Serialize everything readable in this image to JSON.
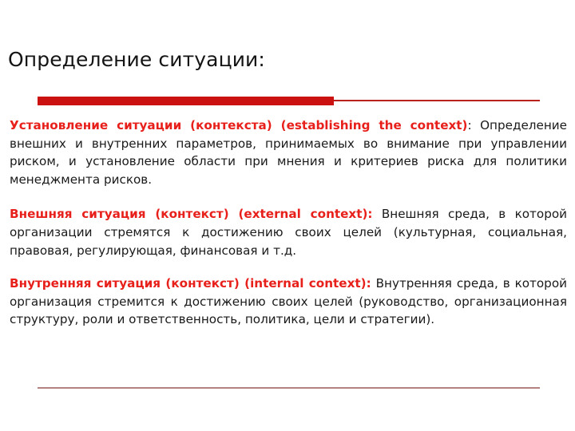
{
  "slide": {
    "title": "Определение ситуации:",
    "accent_color": "#cc1111",
    "term_color": "#e8201b",
    "bottom_rule_color": "#b58080",
    "body_text_color": "#1a1a1a"
  },
  "paragraphs": [
    {
      "term": "Установление ситуации (контекста) (establishing the context)",
      "term_punctuation_black": ":",
      "body": " Определение внешних и внутренних параметров, принимаемых во внимание при управлении риском, и установление области при мнения и критериев риска  для политики менеджмента рисков."
    },
    {
      "term": "Внешняя ситуация (контекст) (external context):",
      "term_punctuation_black": "",
      "body": " Внешняя среда, в которой организации стремятся к достижению своих целей (культурная, социальная, правовая, регулирующая, финансовая и т.д."
    },
    {
      "term": "Внутренняя ситуация (контекст) (internal context):",
      "term_punctuation_black": "",
      "body": " Внутренняя среда, в которой организация стремится к достижению своих целей (руководство, организационная структуру, роли и ответственность, политика, цели и стратегии)."
    }
  ]
}
